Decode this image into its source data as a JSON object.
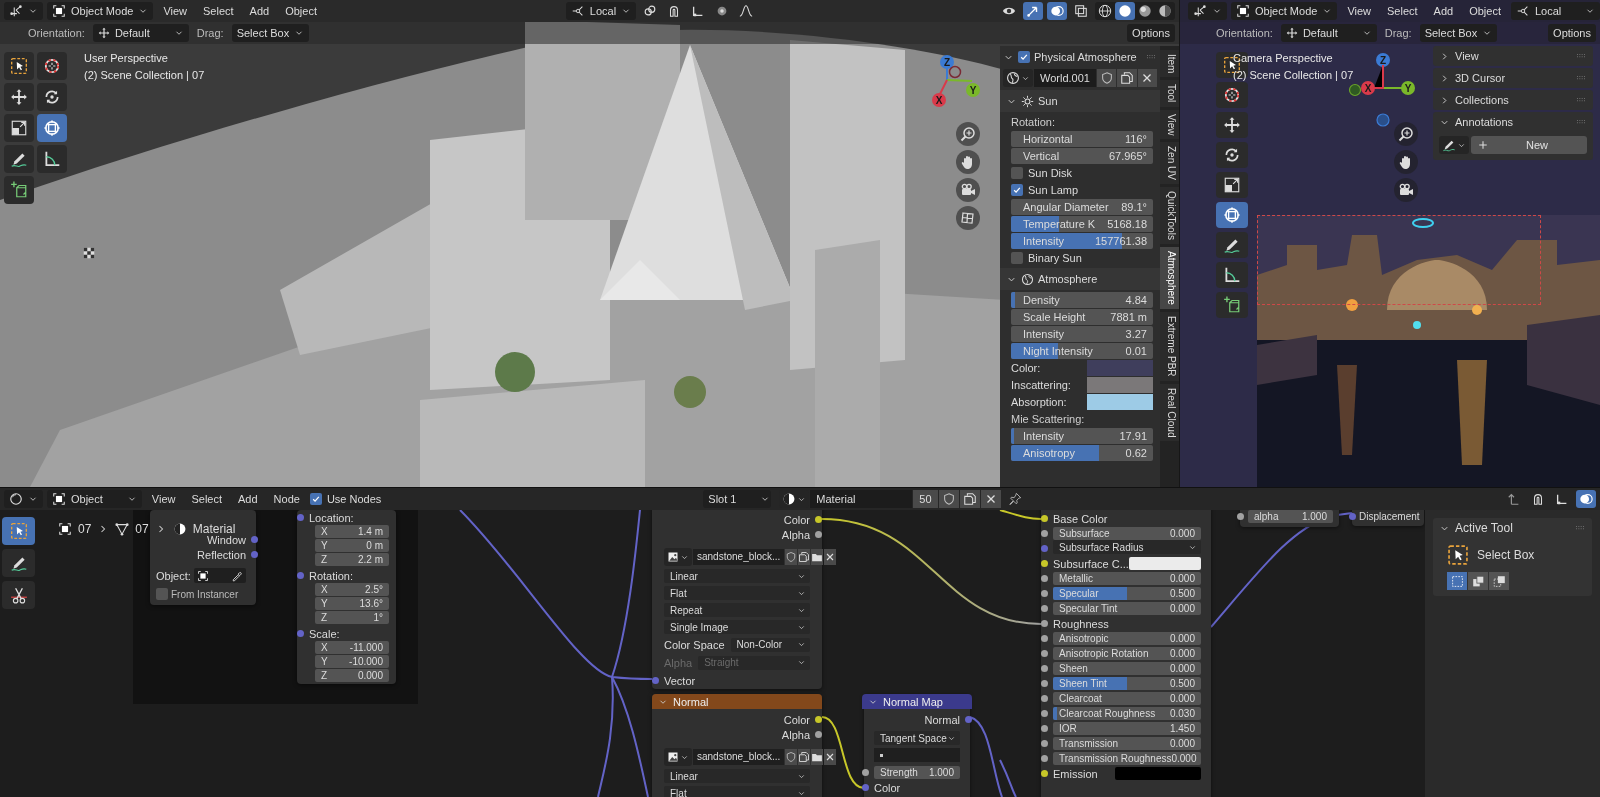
{
  "viewport_3d": {
    "header": {
      "mode": "Object Mode",
      "menus": [
        "View",
        "Select",
        "Add",
        "Object"
      ],
      "pivot": "Local",
      "shading": [
        {
          "kind": "wireframe",
          "selected": false
        },
        {
          "kind": "solid",
          "selected": true
        },
        {
          "kind": "material",
          "selected": false
        },
        {
          "kind": "rendered",
          "selected": false
        }
      ]
    },
    "tool_settings": {
      "orientation_label": "Orientation:",
      "orientation": "Default",
      "drag_label": "Drag:",
      "drag": "Select Box",
      "options": "Options"
    },
    "overlay_text": [
      "User Perspective",
      "(2) Scene Collection | 07"
    ],
    "axes": {
      "x": "X",
      "y": "Y",
      "z": "Z"
    },
    "tools": [
      {
        "kind": "select_box",
        "selected": false
      },
      {
        "kind": "cursor",
        "selected": false
      },
      {
        "kind": "move",
        "selected": false
      },
      {
        "kind": "rotate",
        "selected": false
      },
      {
        "kind": "scale",
        "selected": false
      },
      {
        "kind": "transform",
        "selected": true
      },
      {
        "kind": "annotate",
        "selected": false
      },
      {
        "kind": "measure",
        "selected": false
      },
      {
        "kind": "add_cube",
        "selected": false
      }
    ],
    "sidebar": {
      "title": "Physical Atmosphere",
      "enabled": true,
      "world": "World.001",
      "sections": [
        {
          "title": "Sun",
          "expanded": true,
          "rows": [
            {
              "kind": "label",
              "text": "Rotation:"
            },
            {
              "kind": "field",
              "label": "Horizontal",
              "value": "116°"
            },
            {
              "kind": "field",
              "label": "Vertical",
              "value": "67.965°"
            },
            {
              "kind": "check",
              "label": "Sun Disk",
              "checked": false
            },
            {
              "kind": "check",
              "label": "Sun Lamp",
              "checked": true
            },
            {
              "kind": "field",
              "label": "Angular Diameter",
              "value": "89.1°"
            },
            {
              "kind": "field",
              "label": "Temperature K",
              "value": "5168.18",
              "level": 0.34
            },
            {
              "kind": "field",
              "label": "Intensity",
              "value": "157761.38",
              "level": 0.78
            },
            {
              "kind": "check",
              "label": "Binary Sun",
              "checked": false
            }
          ]
        },
        {
          "title": "Atmosphere",
          "expanded": true,
          "rows": [
            {
              "kind": "field",
              "label": "Density",
              "value": "4.84",
              "level": 0.03
            },
            {
              "kind": "field",
              "label": "Scale Height",
              "value": "7881 m"
            },
            {
              "kind": "field",
              "label": "Intensity",
              "value": "3.27"
            },
            {
              "kind": "field",
              "label": "Night Intensity",
              "value": "0.01",
              "level": 0.33
            },
            {
              "kind": "color",
              "label": "Color:",
              "color": "#3f3e5c"
            },
            {
              "kind": "color",
              "label": "Inscattering:",
              "color": "#7b7879"
            },
            {
              "kind": "color",
              "label": "Absorption:",
              "color": "#9dcbe6"
            },
            {
              "kind": "label",
              "text": "Mie Scattering:"
            },
            {
              "kind": "field",
              "label": "Intensity",
              "value": "17.91",
              "level": 0.02
            },
            {
              "kind": "field",
              "label": "Anisotropy",
              "value": "0.62",
              "level": 0.62
            }
          ]
        }
      ]
    },
    "sidebar_tabs": [
      {
        "label": "Item",
        "selected": false
      },
      {
        "label": "Tool",
        "selected": false
      },
      {
        "label": "View",
        "selected": false
      },
      {
        "label": "Zen UV",
        "selected": false
      },
      {
        "label": "QuickTools",
        "selected": false
      },
      {
        "label": "Atmosphere",
        "selected": true
      },
      {
        "label": "Extreme PBR",
        "selected": false
      },
      {
        "label": "Real Cloud",
        "selected": false
      }
    ]
  },
  "camera_view": {
    "header": {
      "mode": "Object Mode",
      "menus": [
        "View",
        "Select",
        "Add",
        "Object"
      ],
      "pivot": "Local"
    },
    "tool_settings": {
      "orientation_label": "Orientation:",
      "orientation": "Default",
      "drag_label": "Drag:",
      "drag": "Select Box",
      "options": "Options"
    },
    "overlay_text": [
      "Camera Perspective",
      "(2) Scene Collection | 07"
    ],
    "axes": {
      "x": "X",
      "y": "Y",
      "z": "Z"
    },
    "tools": [
      {
        "kind": "select_box",
        "selected": false
      },
      {
        "kind": "cursor",
        "selected": false
      },
      {
        "kind": "move",
        "selected": false
      },
      {
        "kind": "rotate",
        "selected": false
      },
      {
        "kind": "scale",
        "selected": false
      },
      {
        "kind": "transform",
        "selected": true
      },
      {
        "kind": "annotate",
        "selected": false
      },
      {
        "kind": "measure",
        "selected": false
      },
      {
        "kind": "add_cube",
        "selected": false
      }
    ],
    "panels": [
      {
        "title": "View",
        "expanded": false
      },
      {
        "title": "3D Cursor",
        "expanded": false
      },
      {
        "title": "Collections",
        "expanded": false
      },
      {
        "title": "Annotations",
        "expanded": true
      }
    ],
    "annotation_new": "New"
  },
  "node_editor": {
    "header": {
      "type": "Object",
      "menus": [
        "View",
        "Select",
        "Add",
        "Node"
      ],
      "use_nodes": {
        "label": "Use Nodes",
        "checked": true
      },
      "slot": "Slot 1",
      "material": "Material",
      "users": "50"
    },
    "breadcrumb": [
      "07",
      "07",
      "Material"
    ],
    "tools": [
      {
        "kind": "select_box",
        "selected": true
      },
      {
        "kind": "annotate",
        "selected": false
      },
      {
        "kind": "cut",
        "selected": false
      }
    ],
    "texture_coordinate": {
      "outputs": [
        "Window",
        "Reflection"
      ],
      "object_label": "Object:",
      "from_instancer": {
        "label": "From Instancer",
        "checked": false
      }
    },
    "mapping": {
      "groups": [
        {
          "label": "Location:",
          "fields": [
            {
              "axis": "X",
              "value": "1.4 m"
            },
            {
              "axis": "Y",
              "value": "0 m"
            },
            {
              "axis": "Z",
              "value": "2.2 m"
            }
          ]
        },
        {
          "label": "Rotation:",
          "fields": [
            {
              "axis": "X",
              "value": "2.5°"
            },
            {
              "axis": "Y",
              "value": "13.6°"
            },
            {
              "axis": "Z",
              "value": "1°"
            }
          ]
        },
        {
          "label": "Scale:",
          "fields": [
            {
              "axis": "X",
              "value": "-11.000"
            },
            {
              "axis": "Y",
              "value": "-10.000"
            },
            {
              "axis": "Z",
              "value": "0.000"
            }
          ]
        }
      ]
    },
    "image_textures": [
      {
        "outputs": [
          "Color",
          "Alpha"
        ],
        "image": "sandstone_block...",
        "options": [
          "Linear",
          "Flat",
          "Repeat",
          "Single Image"
        ],
        "color_space": {
          "label": "Color Space",
          "value": "Non-Color"
        },
        "alpha_mode": {
          "label": "Alpha",
          "value": "Straight",
          "disabled": true
        },
        "input": "Vector"
      },
      {
        "title": "Normal",
        "outputs": [
          "Color",
          "Alpha"
        ],
        "image": "sandstone_block...",
        "options": [
          "Linear",
          "Flat"
        ]
      }
    ],
    "normal_map": {
      "title": "Normal Map",
      "output": "Normal",
      "space": "Tangent Space",
      "strength": {
        "label": "Strength",
        "value": "1.000"
      },
      "input": "Color"
    },
    "principled": {
      "rows": [
        {
          "kind": "socket",
          "label": "Base Color",
          "color": "#c7c729"
        },
        {
          "kind": "field",
          "label": "Subsurface",
          "value": "0.000",
          "color": "#a1a1a1"
        },
        {
          "kind": "dropdown",
          "label": "Subsurface Radius",
          "color": "#6363c7"
        },
        {
          "kind": "swatch",
          "label": "Subsurface C...",
          "color": "#c7c729",
          "swatch": {
            "color": "#ebebeb"
          }
        },
        {
          "kind": "field",
          "label": "Metallic",
          "value": "0.000",
          "color": "#a1a1a1"
        },
        {
          "kind": "field",
          "label": "Specular",
          "value": "0.500",
          "level": 0.5,
          "color": "#a1a1a1"
        },
        {
          "kind": "field",
          "label": "Specular Tint",
          "value": "0.000",
          "color": "#a1a1a1"
        },
        {
          "kind": "socket",
          "label": "Roughness",
          "color": "#a1a1a1"
        },
        {
          "kind": "field",
          "label": "Anisotropic",
          "value": "0.000",
          "color": "#a1a1a1"
        },
        {
          "kind": "field",
          "label": "Anisotropic Rotation",
          "value": "0.000",
          "color": "#a1a1a1"
        },
        {
          "kind": "field",
          "label": "Sheen",
          "value": "0.000",
          "color": "#a1a1a1"
        },
        {
          "kind": "field",
          "label": "Sheen Tint",
          "value": "0.500",
          "level": 0.5,
          "color": "#a1a1a1"
        },
        {
          "kind": "field",
          "label": "Clearcoat",
          "value": "0.000",
          "color": "#a1a1a1"
        },
        {
          "kind": "field",
          "label": "Clearcoat Roughness",
          "value": "0.030",
          "level": 0.03,
          "color": "#a1a1a1"
        },
        {
          "kind": "field",
          "label": "IOR",
          "value": "1.450",
          "color": "#a1a1a1"
        },
        {
          "kind": "field",
          "label": "Transmission",
          "value": "0.000",
          "color": "#a1a1a1"
        },
        {
          "kind": "field",
          "label": "Transmission Roughness",
          "value": "0.000",
          "color": "#a1a1a1"
        },
        {
          "kind": "swatch",
          "label": "Emission",
          "color": "#c7c729",
          "swatch": {
            "color": "#000000"
          }
        }
      ]
    },
    "value_node": {
      "label": "alpha",
      "value": "1.000"
    },
    "output_node": {
      "input": "Displacement"
    },
    "active_tool": {
      "title": "Active Tool",
      "tool": "Select Box",
      "modes": [
        {
          "selected": true
        },
        {
          "selected": false
        },
        {
          "selected": false
        }
      ]
    }
  }
}
